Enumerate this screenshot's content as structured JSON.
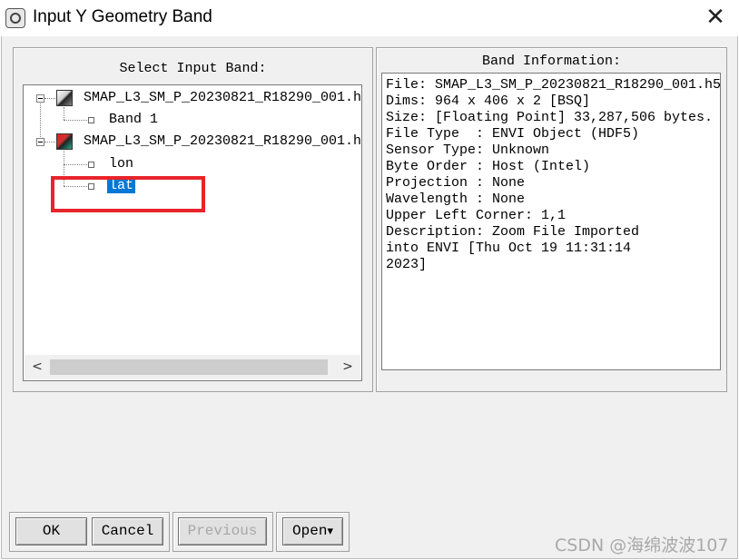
{
  "window": {
    "title": "Input Y Geometry Band",
    "close_glyph": "✕"
  },
  "left_panel": {
    "label": "Select Input Band:",
    "tree": [
      {
        "label": "SMAP_L3_SM_P_20230821_R18290_001.h",
        "children": [
          "Band 1"
        ]
      },
      {
        "label": "SMAP_L3_SM_P_20230821_R18290_001.h",
        "children": [
          "lon",
          "lat"
        ]
      }
    ],
    "selected_band": "lat",
    "scroll_left": "<",
    "scroll_right": ">"
  },
  "right_panel": {
    "label": "Band Information:",
    "lines": [
      "File: SMAP_L3_SM_P_20230821_R18290_001.h5",
      "Dims: 964 x 406 x 2 [BSQ]",
      "Size: [Floating Point] 33,287,506 bytes.",
      "File Type  : ENVI Object (HDF5)",
      "Sensor Type: Unknown",
      "Byte Order : Host (Intel)",
      "Projection : None",
      "Wavelength : None",
      "Upper Left Corner: 1,1",
      "Description: Zoom File Imported",
      "into ENVI [Thu Oct 19 11:31:14",
      "2023]"
    ]
  },
  "buttons": {
    "ok": "OK",
    "cancel": "Cancel",
    "previous": "Previous",
    "open": "Open",
    "open_arrow": "▾"
  },
  "watermark": "CSDN @海绵波波107",
  "colors": {
    "selection": "#0078d7",
    "highlight_rect": "#e8242b"
  }
}
